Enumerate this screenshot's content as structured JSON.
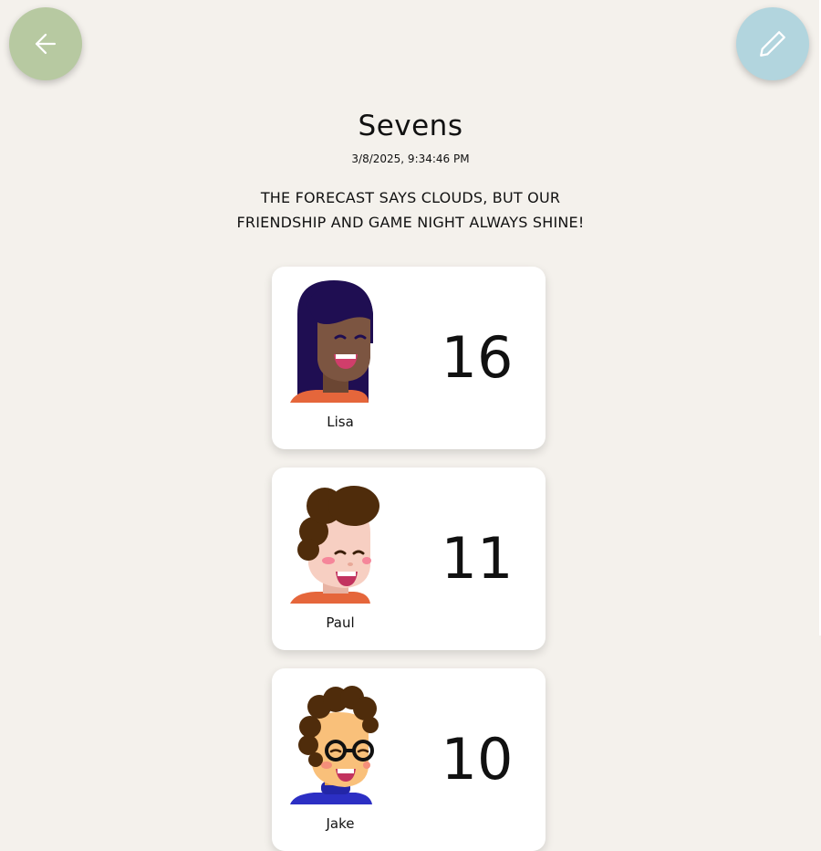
{
  "header": {
    "back_icon": "arrow-left-icon",
    "edit_icon": "pencil-icon",
    "back_color": "#b7c9a1",
    "edit_color": "#b2d5de"
  },
  "game": {
    "title": "Sevens",
    "timestamp": "3/8/2025, 9:34:46 PM",
    "message_line1": "THE FORECAST SAYS CLOUDS, BUT OUR",
    "message_line2": "FRIENDSHIP AND GAME NIGHT ALWAYS SHINE!"
  },
  "players": [
    {
      "name": "Lisa",
      "score": "16",
      "avatar": "avatar-lisa-icon"
    },
    {
      "name": "Paul",
      "score": "11",
      "avatar": "avatar-paul-icon"
    },
    {
      "name": "Jake",
      "score": "10",
      "avatar": "avatar-jake-icon"
    }
  ]
}
